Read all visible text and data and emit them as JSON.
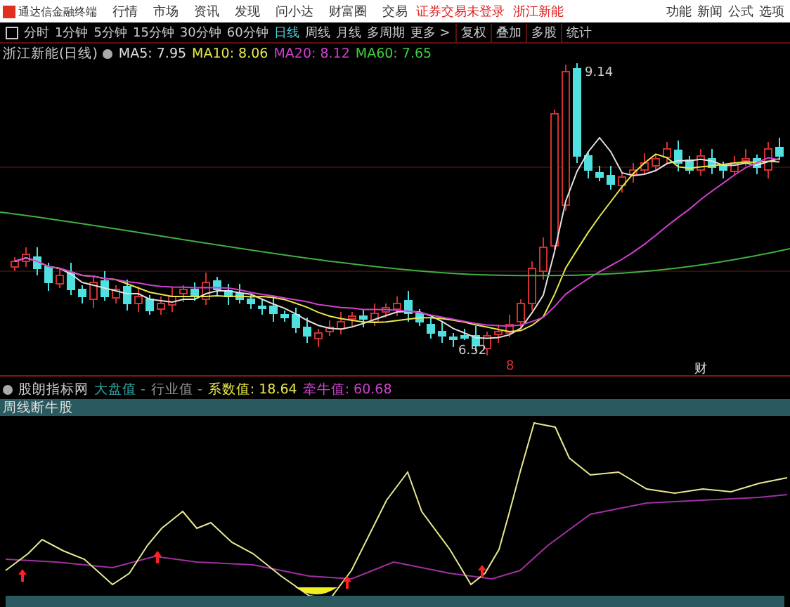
{
  "menu_bar": {
    "app_name": "通达信金融终端",
    "items": [
      "行情",
      "市场",
      "资讯",
      "发现",
      "问小达",
      "财富圈",
      "交易"
    ],
    "notice": "证券交易未登录",
    "stock": "浙江新能",
    "right_items": [
      "功能",
      "新闻",
      "公式",
      "选项"
    ]
  },
  "toolbar": {
    "periods": [
      {
        "label": "分时",
        "selected": false
      },
      {
        "label": "1分钟",
        "selected": false
      },
      {
        "label": "5分钟",
        "selected": false
      },
      {
        "label": "15分钟",
        "selected": false
      },
      {
        "label": "30分钟",
        "selected": false
      },
      {
        "label": "60分钟",
        "selected": false
      },
      {
        "label": "日线",
        "selected": true
      },
      {
        "label": "周线",
        "selected": false
      },
      {
        "label": "月线",
        "selected": false
      },
      {
        "label": "多周期",
        "selected": false
      },
      {
        "label": "更多 >",
        "selected": false
      }
    ],
    "tools": [
      "复权",
      "叠加",
      "多股",
      "统计"
    ]
  },
  "main_chart": {
    "title": "浙江新能(日线)",
    "averages": [
      {
        "label": "MA5: ",
        "value": "7.95",
        "color": "#e0e0e0"
      },
      {
        "label": "MA10: ",
        "value": "8.06",
        "color": "#e8e84a"
      },
      {
        "label": "MA20: ",
        "value": "8.12",
        "color": "#d040d0"
      },
      {
        "label": "MA60: ",
        "value": "7.65",
        "color": "#40d040"
      }
    ],
    "high_label": "9.14",
    "low_label": "6.52",
    "event_marks": [
      {
        "text": "8",
        "color": "#e03030"
      },
      {
        "text": "财",
        "color": "#e0e0e0"
      }
    ]
  },
  "indicator": {
    "name": "股朗指标网",
    "values": [
      {
        "label": "大盘值",
        "value": "-",
        "color": "#30a0a0"
      },
      {
        "label": "行业值",
        "value": "-",
        "color": "#909090"
      },
      {
        "label": "系数值: ",
        "value": "18.64",
        "color": "#e8e84a"
      },
      {
        "label": "牵牛值: ",
        "value": "60.68",
        "color": "#d040d0"
      }
    ],
    "band_label": "周线断牛股"
  }
}
